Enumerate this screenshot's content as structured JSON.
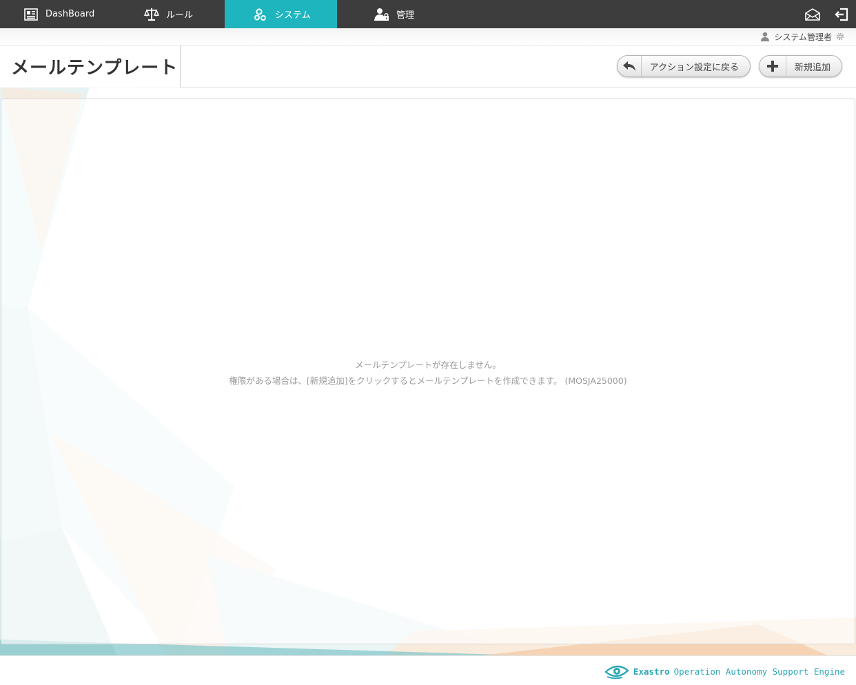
{
  "nav": {
    "items": [
      {
        "label": "DashBoard",
        "icon": "dashboard-icon"
      },
      {
        "label": "ルール",
        "icon": "scale-icon"
      },
      {
        "label": "システム",
        "icon": "gears-icon",
        "active": true
      },
      {
        "label": "管理",
        "icon": "user-lock-icon"
      }
    ],
    "right_icons": [
      "mail-icon",
      "logout-icon"
    ]
  },
  "user": {
    "name": "システム管理者"
  },
  "page": {
    "title": "メールテンプレート",
    "back_label": "アクション設定に戻る",
    "new_label": "新規追加"
  },
  "content": {
    "empty_line1": "メールテンプレートが存在しません。",
    "empty_line2": "権限がある場合は、[新規追加]をクリックするとメールテンプレートを作成できます。 (MOSJA25000)"
  },
  "footer": {
    "brand_name": "Exastro",
    "brand_tagline": "Operation Autonomy Support Engine"
  },
  "colors": {
    "nav_bg": "#3d3d3d",
    "accent": "#1fb5bf",
    "brand": "#2aa6b5"
  }
}
